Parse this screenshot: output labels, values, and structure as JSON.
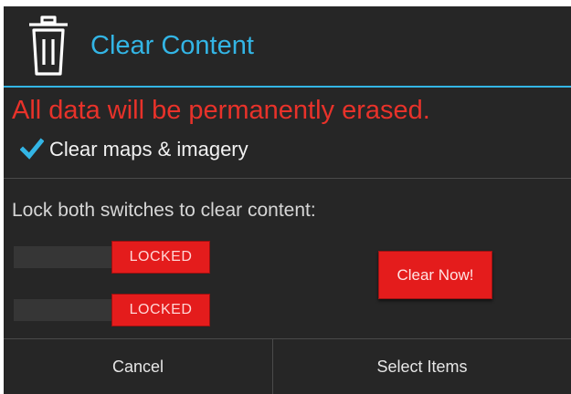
{
  "dialog": {
    "title": "Clear Content",
    "title_icon": "trash-icon",
    "warning": "All data will be permanently erased.",
    "checkbox": {
      "label": "Clear maps & imagery",
      "checked": true
    },
    "instruction": "Lock both switches to clear content:",
    "switches": [
      {
        "state_label": "LOCKED"
      },
      {
        "state_label": "LOCKED"
      }
    ],
    "clear_now_label": "Clear Now!",
    "footer": {
      "cancel_label": "Cancel",
      "select_items_label": "Select Items"
    }
  },
  "colors": {
    "background": "#262626",
    "accent": "#33b5e5",
    "warning": "#e8322a",
    "danger_button": "#e41c1c"
  }
}
